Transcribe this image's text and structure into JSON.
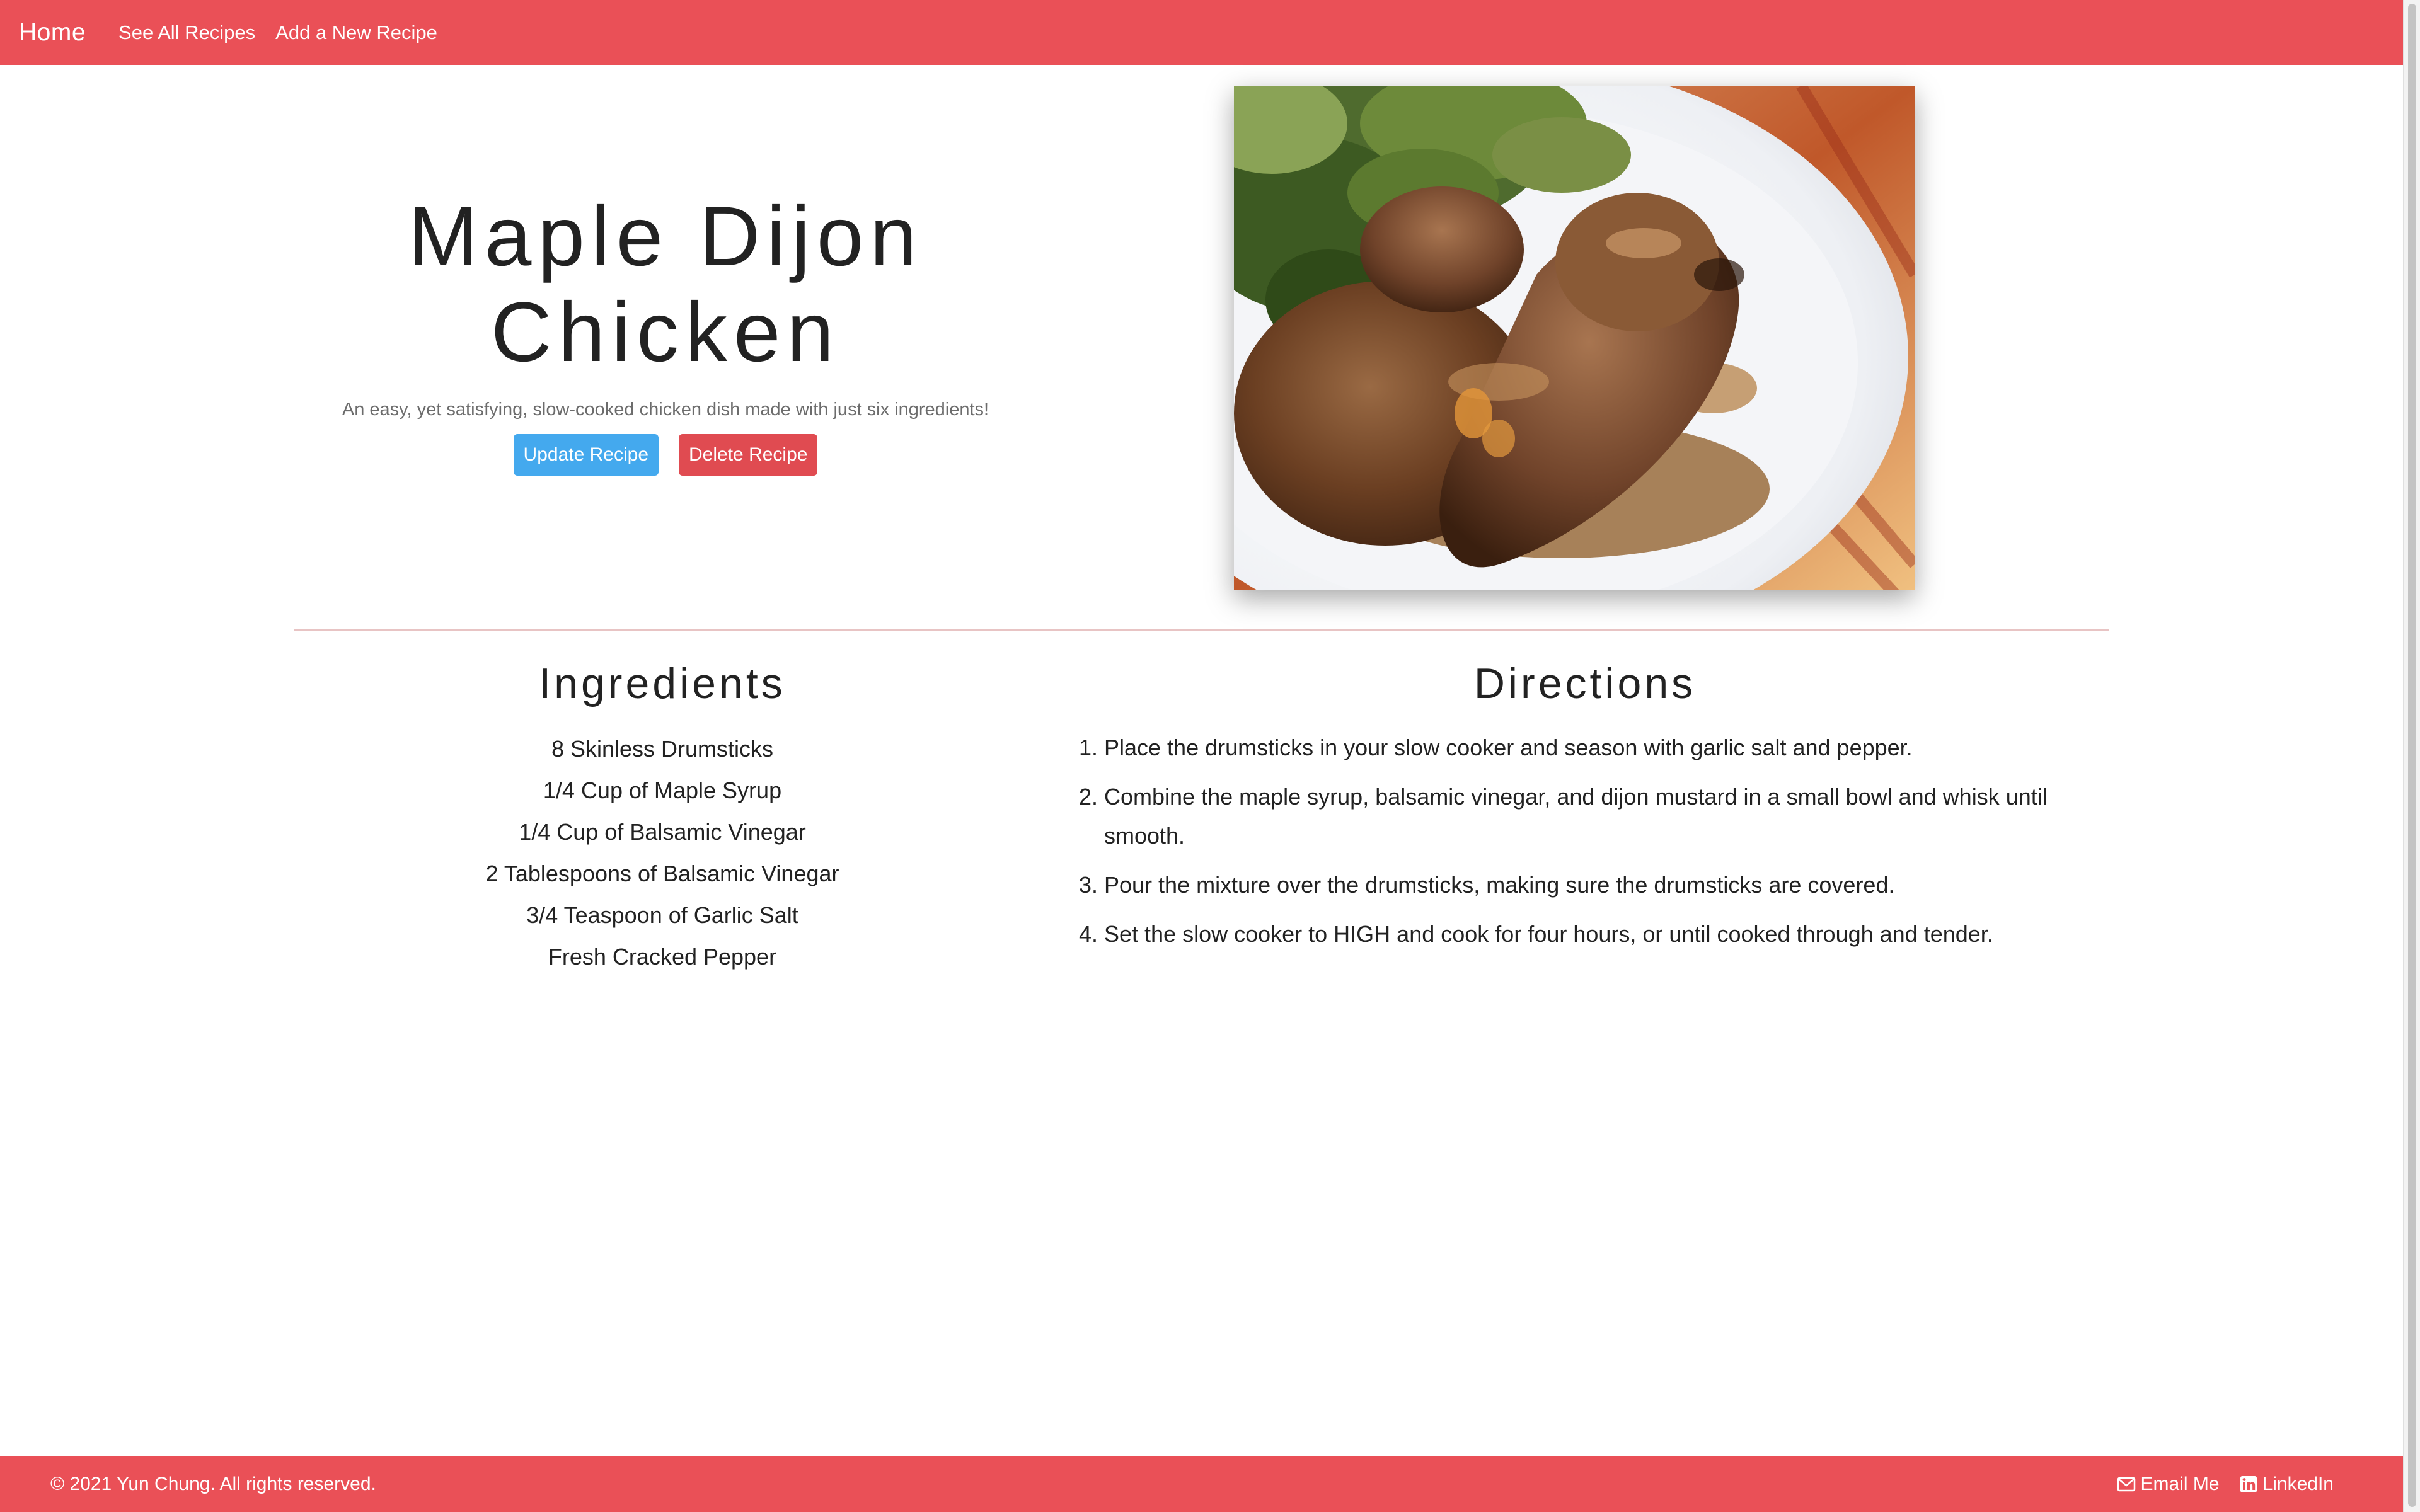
{
  "nav": {
    "brand": "Home",
    "links": [
      "See All Recipes",
      "Add a New Recipe"
    ]
  },
  "recipe": {
    "title_line1": "Maple Dijon",
    "title_line2": "Chicken",
    "description": "An easy, yet satisfying, slow-cooked chicken dish made with just six ingredients!",
    "update_label": "Update Recipe",
    "delete_label": "Delete Recipe",
    "image_alt": "Maple Dijon Chicken drumsticks on a plate"
  },
  "ingredients": {
    "heading": "Ingredients",
    "items": [
      "8 Skinless Drumsticks",
      "1/4 Cup of Maple Syrup",
      "1/4 Cup of Balsamic Vinegar",
      "2 Tablespoons of Balsamic Vinegar",
      "3/4 Teaspoon of Garlic Salt",
      "Fresh Cracked Pepper"
    ]
  },
  "directions": {
    "heading": "Directions",
    "steps": [
      "Place the drumsticks in your slow cooker and season with garlic salt and pepper.",
      "Combine the maple syrup, balsamic vinegar, and dijon mustard in a small bowl and whisk until smooth.",
      "Pour the mixture over the drumsticks, making sure the drumsticks are covered.",
      "Set the slow cooker to HIGH and cook for four hours, or until cooked through and tender."
    ]
  },
  "footer": {
    "copyright": "© 2021 Yun Chung. All rights reserved.",
    "email_label": "Email Me",
    "linkedin_label": "LinkedIn"
  },
  "colors": {
    "brand": "#ea5057",
    "update_button": "#44a9ee",
    "delete_button": "#e04b51"
  }
}
